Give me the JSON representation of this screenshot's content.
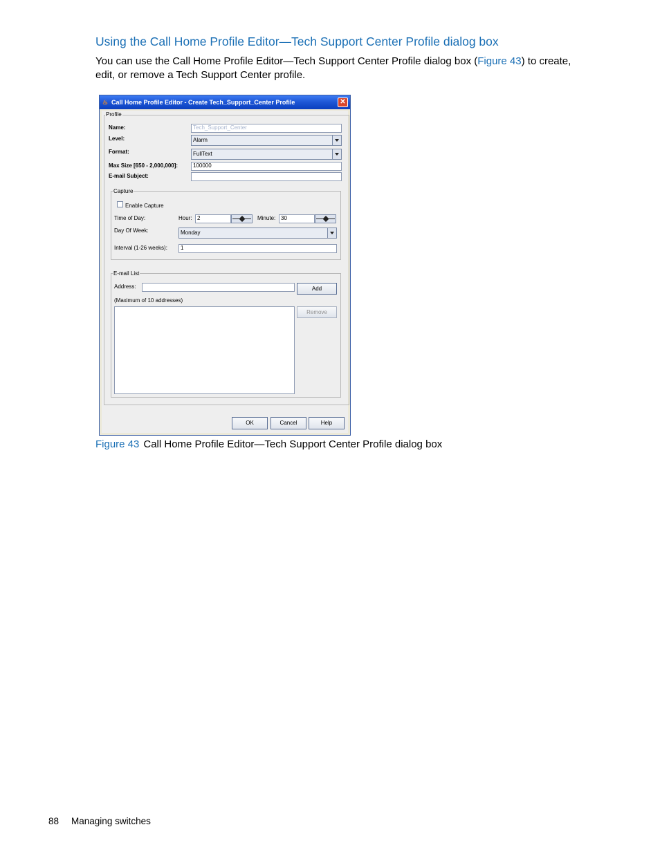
{
  "heading": "Using the Call Home Profile Editor—Tech Support Center Profile dialog box",
  "intro": {
    "before": "You can use the Call Home Profile Editor—Tech Support Center Profile dialog box (",
    "link": "Figure 43",
    "after": ") to create, edit, or remove a Tech Support Center profile."
  },
  "dialog": {
    "title": "Call Home Profile Editor - Create Tech_Support_Center Profile",
    "profile_group": "Profile",
    "name_label": "Name:",
    "name_value": "Tech_Support_Center",
    "level_label": "Level:",
    "level_value": "Alarm",
    "format_label": "Format:",
    "format_value": "FullText",
    "maxsize_label": "Max Size [650 - 2,000,000]:",
    "maxsize_value": "100000",
    "subject_label": "E-mail Subject:",
    "subject_value": "",
    "capture": {
      "group": "Capture",
      "enable_label": "Enable Capture",
      "time_label": "Time of Day:",
      "hour_label": "Hour:",
      "hour_value": "2",
      "minute_label": "Minute:",
      "minute_value": "30",
      "dow_label": "Day Of Week:",
      "dow_value": "Monday",
      "interval_label": "Interval (1-26 weeks):",
      "interval_value": "1"
    },
    "email": {
      "group": "E-mail List",
      "address_label": "Address:",
      "address_value": "",
      "add_button": "Add",
      "max_note": "(Maximum of 10 addresses)",
      "remove_button": "Remove"
    },
    "ok_button": "OK",
    "cancel_button": "Cancel",
    "help_button": "Help"
  },
  "caption": {
    "figure": "Figure 43",
    "text": "Call Home Profile Editor—Tech Support Center Profile dialog box"
  },
  "footer": {
    "page_number": "88",
    "section": "Managing switches"
  }
}
